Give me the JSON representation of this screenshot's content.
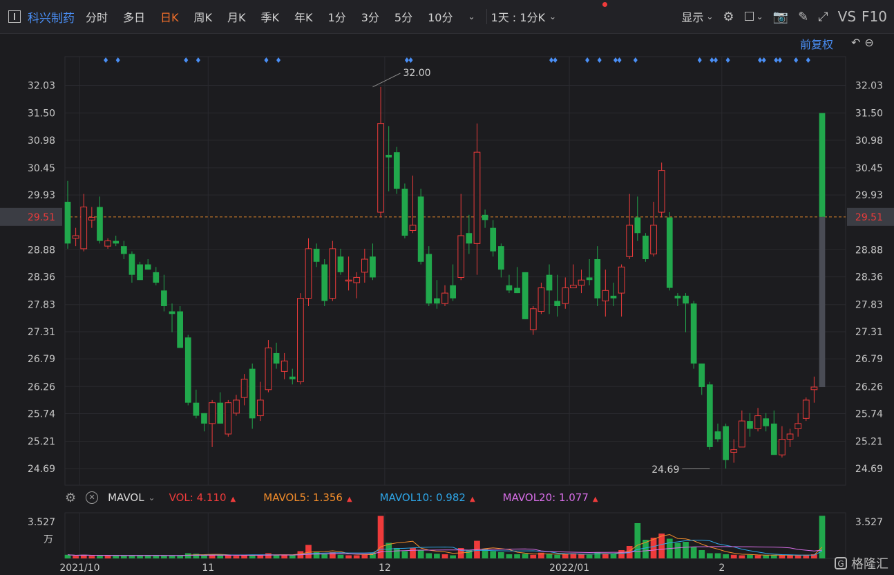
{
  "toolbar": {
    "stock_name": "科兴制药",
    "periods": [
      {
        "label": "分时",
        "active": false
      },
      {
        "label": "多日",
        "active": false
      },
      {
        "label": "日K",
        "active": true
      },
      {
        "label": "周K",
        "active": false
      },
      {
        "label": "月K",
        "active": false
      },
      {
        "label": "季K",
        "active": false
      },
      {
        "label": "年K",
        "active": false
      },
      {
        "label": "1分",
        "active": false
      },
      {
        "label": "3分",
        "active": false
      },
      {
        "label": "5分",
        "active": false
      },
      {
        "label": "10分",
        "active": false
      }
    ],
    "range_label": "1天 : 1分K",
    "display_label": "显示",
    "vs_label": "VS",
    "f10_label": "F10",
    "adjust_label": "前复权"
  },
  "colors": {
    "up": "#ee3b3b",
    "down": "#21a84c",
    "ma5": "#f28c2a",
    "ma10": "#2ea6e8",
    "ma20": "#d86ee8"
  },
  "chart_data": {
    "type": "candlestick",
    "y_ticks": [
      "32.03",
      "31.50",
      "30.98",
      "30.45",
      "29.93",
      "29.51",
      "28.88",
      "28.36",
      "27.83",
      "27.31",
      "26.79",
      "26.26",
      "25.74",
      "25.21",
      "24.69"
    ],
    "ylim": [
      24.37,
      32.58
    ],
    "current_price": "29.51",
    "x_labels": [
      {
        "label": "2021/10",
        "index": 2
      },
      {
        "label": "11",
        "index": 18
      },
      {
        "label": "12",
        "index": 40
      },
      {
        "label": "2022/01",
        "index": 63
      },
      {
        "label": "2",
        "index": 82
      }
    ],
    "max_label": {
      "text": "32.00",
      "index": 38
    },
    "min_label": {
      "text": "24.69",
      "index": 80
    },
    "ohlc": [
      [
        29.8,
        30.2,
        28.9,
        29.0
      ],
      [
        29.1,
        29.3,
        28.95,
        29.15
      ],
      [
        28.9,
        29.95,
        28.85,
        29.7
      ],
      [
        29.45,
        29.7,
        29.3,
        29.5
      ],
      [
        29.7,
        29.9,
        29.0,
        29.05
      ],
      [
        28.95,
        29.1,
        28.9,
        29.05
      ],
      [
        29.05,
        29.15,
        28.95,
        29.0
      ],
      [
        28.95,
        29.05,
        28.7,
        28.8
      ],
      [
        28.8,
        28.85,
        28.25,
        28.4
      ],
      [
        28.6,
        28.65,
        28.3,
        28.3
      ],
      [
        28.6,
        28.7,
        28.5,
        28.5
      ],
      [
        28.45,
        28.55,
        28.2,
        28.25
      ],
      [
        28.1,
        28.4,
        27.7,
        27.8
      ],
      [
        27.7,
        27.85,
        27.3,
        27.65
      ],
      [
        27.7,
        27.8,
        27.0,
        27.0
      ],
      [
        27.2,
        27.25,
        25.9,
        25.95
      ],
      [
        25.95,
        26.2,
        25.65,
        25.7
      ],
      [
        25.75,
        25.75,
        25.4,
        25.55
      ],
      [
        25.55,
        26.0,
        25.1,
        25.95
      ],
      [
        25.95,
        26.15,
        25.55,
        25.55
      ],
      [
        25.35,
        26.0,
        25.3,
        25.95
      ],
      [
        25.75,
        26.1,
        25.7,
        26.0
      ],
      [
        26.05,
        26.5,
        25.9,
        26.4
      ],
      [
        26.6,
        26.7,
        25.45,
        25.65
      ],
      [
        25.7,
        26.35,
        25.6,
        26.0
      ],
      [
        26.2,
        27.15,
        26.15,
        27.0
      ],
      [
        26.9,
        27.1,
        26.6,
        26.7
      ],
      [
        26.55,
        26.9,
        26.4,
        26.75
      ],
      [
        26.45,
        26.6,
        26.3,
        26.4
      ],
      [
        26.35,
        28.05,
        26.3,
        27.95
      ],
      [
        27.95,
        29.1,
        27.8,
        28.9
      ],
      [
        28.9,
        29.0,
        28.55,
        28.65
      ],
      [
        28.6,
        28.7,
        27.8,
        27.9
      ],
      [
        27.95,
        29.05,
        27.9,
        28.9
      ],
      [
        28.75,
        28.9,
        28.4,
        28.45
      ],
      [
        28.3,
        28.75,
        28.1,
        28.3
      ],
      [
        28.25,
        28.45,
        27.95,
        28.35
      ],
      [
        28.45,
        28.9,
        28.25,
        28.7
      ],
      [
        28.75,
        29.0,
        28.3,
        28.35
      ],
      [
        29.6,
        32.0,
        29.5,
        31.3
      ],
      [
        30.7,
        31.25,
        30.0,
        30.65
      ],
      [
        30.75,
        30.85,
        29.95,
        30.05
      ],
      [
        30.05,
        30.15,
        29.1,
        29.15
      ],
      [
        29.25,
        30.3,
        29.2,
        29.35
      ],
      [
        29.9,
        30.05,
        28.6,
        28.65
      ],
      [
        28.8,
        28.95,
        27.8,
        27.85
      ],
      [
        27.95,
        28.3,
        27.75,
        27.85
      ],
      [
        27.85,
        28.2,
        27.8,
        28.05
      ],
      [
        28.2,
        28.6,
        27.9,
        27.95
      ],
      [
        28.35,
        29.95,
        28.3,
        29.15
      ],
      [
        29.2,
        29.55,
        28.8,
        29.0
      ],
      [
        29.0,
        31.3,
        28.4,
        30.75
      ],
      [
        29.55,
        29.65,
        29.3,
        29.45
      ],
      [
        29.3,
        29.45,
        28.75,
        28.85
      ],
      [
        28.95,
        29.0,
        28.35,
        28.5
      ],
      [
        28.2,
        28.4,
        28.05,
        28.1
      ],
      [
        28.15,
        28.55,
        28.05,
        28.05
      ],
      [
        28.45,
        28.45,
        27.55,
        27.55
      ],
      [
        27.35,
        27.8,
        27.25,
        27.75
      ],
      [
        27.7,
        28.25,
        27.65,
        28.15
      ],
      [
        28.4,
        28.6,
        27.65,
        28.1
      ],
      [
        27.9,
        28.4,
        27.6,
        27.8
      ],
      [
        27.85,
        28.35,
        27.75,
        28.15
      ],
      [
        28.15,
        28.6,
        28.15,
        28.2
      ],
      [
        28.2,
        28.5,
        28.05,
        28.3
      ],
      [
        28.35,
        28.7,
        28.2,
        28.3
      ],
      [
        28.7,
        28.95,
        27.8,
        27.95
      ],
      [
        27.9,
        28.5,
        27.6,
        28.1
      ],
      [
        28.0,
        28.25,
        27.8,
        27.95
      ],
      [
        28.05,
        28.6,
        27.6,
        28.55
      ],
      [
        28.75,
        29.95,
        28.7,
        29.35
      ],
      [
        29.5,
        29.9,
        29.05,
        29.2
      ],
      [
        29.15,
        29.2,
        28.65,
        28.7
      ],
      [
        28.8,
        29.8,
        28.75,
        29.35
      ],
      [
        29.6,
        30.55,
        29.5,
        30.4
      ],
      [
        29.5,
        29.6,
        28.1,
        28.15
      ],
      [
        28.0,
        28.05,
        27.8,
        27.95
      ],
      [
        28.0,
        28.05,
        27.3,
        27.85
      ],
      [
        27.85,
        27.9,
        26.6,
        26.7
      ],
      [
        26.7,
        26.7,
        26.1,
        26.25
      ],
      [
        26.3,
        26.35,
        25.05,
        25.1
      ],
      [
        25.4,
        25.55,
        25.2,
        25.25
      ],
      [
        25.5,
        25.55,
        24.69,
        24.85
      ],
      [
        25.0,
        25.25,
        24.8,
        25.05
      ],
      [
        25.1,
        25.8,
        25.1,
        25.6
      ],
      [
        25.6,
        25.75,
        25.3,
        25.45
      ],
      [
        25.45,
        25.85,
        25.4,
        25.7
      ],
      [
        25.65,
        25.75,
        25.4,
        25.5
      ],
      [
        25.55,
        25.8,
        24.95,
        24.95
      ],
      [
        24.95,
        25.5,
        24.9,
        25.25
      ],
      [
        25.25,
        25.45,
        25.1,
        25.35
      ],
      [
        25.45,
        25.75,
        25.3,
        25.55
      ],
      [
        25.65,
        26.05,
        25.6,
        26.0
      ],
      [
        26.2,
        26.45,
        25.95,
        26.25
      ],
      [
        29.51,
        31.5,
        29.51,
        31.5
      ]
    ],
    "volume": {
      "y_ticks": [
        "3.527"
      ],
      "unit": "万",
      "ylim": [
        0,
        4.4
      ],
      "values": [
        0.35,
        0.25,
        0.35,
        0.25,
        0.3,
        0.25,
        0.25,
        0.3,
        0.28,
        0.3,
        0.25,
        0.25,
        0.3,
        0.25,
        0.3,
        0.5,
        0.45,
        0.35,
        0.35,
        0.3,
        0.3,
        0.25,
        0.3,
        0.35,
        0.3,
        0.5,
        0.3,
        0.35,
        0.3,
        0.7,
        1.3,
        0.6,
        0.45,
        0.6,
        0.35,
        0.3,
        0.3,
        0.35,
        0.55,
        4.1,
        1.5,
        1.0,
        0.7,
        1.0,
        0.8,
        0.5,
        0.45,
        0.4,
        0.3,
        1.0,
        0.8,
        1.7,
        0.9,
        0.7,
        0.6,
        0.4,
        0.4,
        0.45,
        0.35,
        0.55,
        0.4,
        0.35,
        0.4,
        0.5,
        0.4,
        0.35,
        0.6,
        0.5,
        0.5,
        0.8,
        1.2,
        3.4,
        1.8,
        2.0,
        2.4,
        1.9,
        1.5,
        1.6,
        1.1,
        0.8,
        0.5,
        0.5,
        0.4,
        0.35,
        0.3,
        0.35,
        0.3,
        0.3,
        0.35,
        0.3,
        0.3,
        0.3,
        0.35,
        0.4,
        4.11
      ],
      "vol": "4.110",
      "mavol5": "1.356",
      "mavol10": "0.982",
      "mavol20": "1.077"
    }
  },
  "mavol_row": {
    "indicator": "MAVOL",
    "vol_label": "VOL: 4.110",
    "mavol5_label": "MAVOL5: 1.356",
    "mavol10_label": "MAVOL10: 0.982",
    "mavol20_label": "MAVOL20: 1.077"
  },
  "watermark": "格隆汇"
}
